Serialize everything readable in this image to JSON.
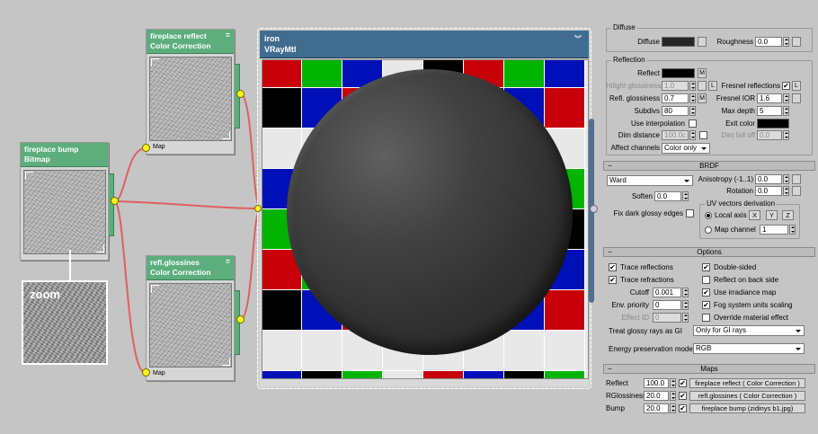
{
  "nodes": {
    "reflect": {
      "title": "fireplace reflect",
      "type": "Color Correction",
      "slot": "Map"
    },
    "bump": {
      "title": "fireplace bump",
      "type": "Bitmap"
    },
    "gloss": {
      "title": "refl.glossines",
      "type": "Color Correction",
      "slot": "Map"
    },
    "material": {
      "title": "iron",
      "type": "VRayMtl"
    },
    "zoom_label": "zoom"
  },
  "checker_colors": {
    "red": "#c8000a",
    "blue": "#0010b8",
    "black": "#000000",
    "green": "#00b400",
    "white": "#e8e8e8"
  },
  "diffuse": {
    "title": "Diffuse",
    "diffuse_label": "Diffuse",
    "roughness_label": "Roughness",
    "roughness": "0.0"
  },
  "reflection": {
    "title": "Reflection",
    "reflect_label": "Reflect",
    "m": "M",
    "l": "L",
    "hilight_label": "Hilight glossiness",
    "hilight": "1.0",
    "refl_gloss_label": "Refl. glossiness",
    "refl_gloss": "0.7",
    "subdivs_label": "Subdivs",
    "subdivs": "80",
    "use_interp_label": "Use interpolation",
    "dim_dist_label": "Dim distance",
    "dim_dist": "100.0c",
    "affect_label": "Affect channels",
    "affect": "Color only",
    "fresnel_label": "Fresnel reflections",
    "fresnel_ior_label": "Fresnel IOR",
    "fresnel_ior": "1.6",
    "max_depth_label": "Max depth",
    "max_depth": "5",
    "exit_color_label": "Exit color",
    "dim_falloff_label": "Dim fall off",
    "dim_falloff": "0.0"
  },
  "brdf": {
    "title": "BRDF",
    "type": "Ward",
    "soften_label": "Soften",
    "soften": "0.0",
    "fix_dark_label": "Fix dark glossy edges",
    "aniso_label": "Anisotropy (-1..1)",
    "aniso": "0.0",
    "rotation_label": "Rotation",
    "rotation": "0.0",
    "uv_title": "UV vectors derivation",
    "local_axis_label": "Local axis",
    "x": "X",
    "y": "Y",
    "z": "Z",
    "map_channel_label": "Map channel",
    "map_channel": "1"
  },
  "options": {
    "title": "Options",
    "trace_refl": "Trace reflections",
    "trace_refr": "Trace refractions",
    "cutoff_label": "Cutoff",
    "cutoff": "0.001",
    "env_label": "Env. priority",
    "env": "0",
    "effect_label": "Effect ID",
    "effect": "0",
    "double_sided": "Double-sided",
    "reflect_back": "Reflect on back side",
    "use_irr": "Use irradiance map",
    "fog_units": "Fog system units scaling",
    "override": "Override material effect",
    "glossy_gi_label": "Treat glossy rays as GI",
    "glossy_gi": "Only for GI rays",
    "energy_label": "Energy preservation mode:",
    "energy": "RGB"
  },
  "maps": {
    "title": "Maps",
    "rows": [
      {
        "label": "Reflect",
        "amount": "100.0",
        "map": "fireplace reflect  ( Color Correction )"
      },
      {
        "label": "RGlossiness",
        "amount": "20.0",
        "map": "refl.glossines  ( Color Correction )"
      },
      {
        "label": "Bump",
        "amount": "20.0",
        "map": "fireplace bump (zidinys b1.jpg)"
      }
    ]
  },
  "glyphs": {
    "check": "✔",
    "minus": "−",
    "node_min": "=",
    "chevron": "︾"
  }
}
